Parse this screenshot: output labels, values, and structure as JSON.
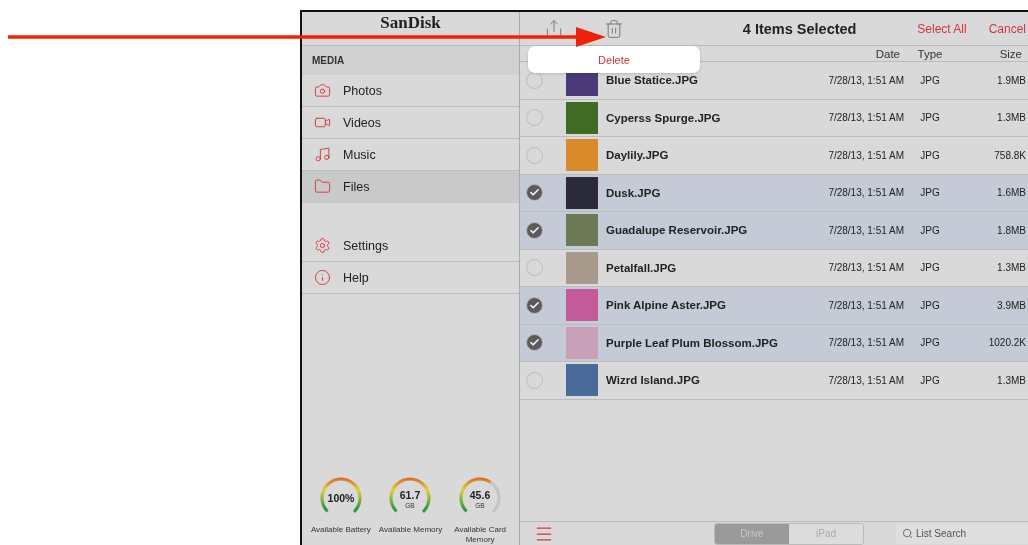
{
  "annotation": {
    "kind": "arrow"
  },
  "sidebar": {
    "logo": "SanDisk",
    "section_title": "MEDIA",
    "media_items": [
      {
        "label": "Photos",
        "selected": false
      },
      {
        "label": "Videos",
        "selected": false
      },
      {
        "label": "Music",
        "selected": false
      },
      {
        "label": "Files",
        "selected": true
      }
    ],
    "other_items": [
      {
        "label": "Settings",
        "selected": false
      },
      {
        "label": "Help",
        "selected": false
      }
    ],
    "gauges": [
      {
        "value": "100%",
        "label": "Available Battery",
        "level": 1.0
      },
      {
        "value": "61.7",
        "unit": "GB",
        "label": "Available Memory",
        "level": 1.0
      },
      {
        "value": "45.6",
        "unit": "GB",
        "label": "Available Card Memory",
        "level": 0.62
      }
    ]
  },
  "toolbar": {
    "title": "4 Items Selected",
    "select_all": "Select All",
    "cancel": "Cancel"
  },
  "popover": {
    "action": "Delete"
  },
  "table": {
    "columns": [
      "Date",
      "Type",
      "Size"
    ],
    "rows": [
      {
        "name": "Blue Statice.JPG",
        "date": "7/28/13, 1:51 AM",
        "type": "JPG",
        "size": "1.9MB",
        "selected": false,
        "color": "#4a3a78"
      },
      {
        "name": "Cyperss Spurge.JPG",
        "date": "7/28/13, 1:51 AM",
        "type": "JPG",
        "size": "1.3MB",
        "selected": false,
        "color": "#3f6b25"
      },
      {
        "name": "Daylily.JPG",
        "date": "7/28/13, 1:51 AM",
        "type": "JPG",
        "size": "758.8K",
        "selected": false,
        "color": "#d98a2a"
      },
      {
        "name": "Dusk.JPG",
        "date": "7/28/13, 1:51 AM",
        "type": "JPG",
        "size": "1.6MB",
        "selected": true,
        "color": "#2b2a3a"
      },
      {
        "name": "Guadalupe Reservoir.JPG",
        "date": "7/28/13, 1:51 AM",
        "type": "JPG",
        "size": "1.8MB",
        "selected": true,
        "color": "#6b7a55"
      },
      {
        "name": "Petalfall.JPG",
        "date": "7/28/13, 1:51 AM",
        "type": "JPG",
        "size": "1.3MB",
        "selected": false,
        "color": "#a89a8c"
      },
      {
        "name": "Pink Alpine Aster.JPG",
        "date": "7/28/13, 1:51 AM",
        "type": "JPG",
        "size": "3.9MB",
        "selected": true,
        "color": "#c45a9a"
      },
      {
        "name": "Purple Leaf Plum Blossom.JPG",
        "date": "7/28/13, 1:51 AM",
        "type": "JPG",
        "size": "1020.2K",
        "selected": true,
        "color": "#c8a0b8"
      },
      {
        "name": "Wizrd Island.JPG",
        "date": "7/28/13, 1:51 AM",
        "type": "JPG",
        "size": "1.3MB",
        "selected": false,
        "color": "#4a6a9a"
      }
    ]
  },
  "bottom_bar": {
    "segments": [
      {
        "label": "Drive",
        "selected": true
      },
      {
        "label": "iPad",
        "selected": false
      }
    ],
    "search": {
      "placeholder": "List Search"
    }
  }
}
